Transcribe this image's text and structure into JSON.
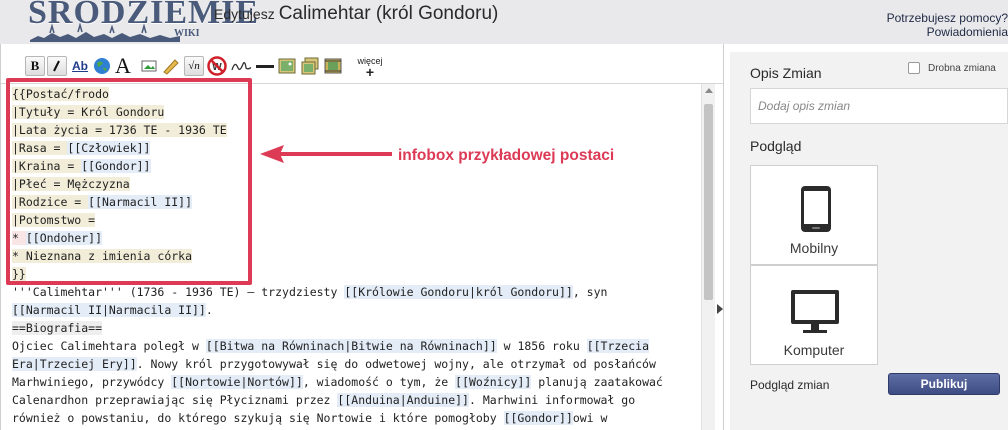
{
  "header": {
    "logo_text": "ŚRODZIEMIE",
    "logo_wiki": "WIKI",
    "edit_prefix": "Edytujesz",
    "page_title": "Calimehtar (król Gondoru)",
    "help_link": "Potrzebujesz pomocy?",
    "notifications_link": "Powiadomienia"
  },
  "toolbar": {
    "buttons": [
      {
        "name": "bold-button",
        "label": "B"
      },
      {
        "name": "italic-button",
        "label": "I"
      },
      {
        "name": "internal-link-button",
        "label": "Ab"
      },
      {
        "name": "external-link-button",
        "icon": "globe-icon"
      },
      {
        "name": "headline-button",
        "label": "A"
      },
      {
        "name": "embedded-image-button",
        "icon": "image-icon"
      },
      {
        "name": "media-link-button",
        "icon": "pencil-icon"
      },
      {
        "name": "math-button",
        "label": "√n"
      },
      {
        "name": "nowiki-button",
        "icon": "no-wiki-icon"
      },
      {
        "name": "signature-button",
        "icon": "signature-icon"
      },
      {
        "name": "horizontal-line-button",
        "icon": "horizontal-line-icon"
      },
      {
        "name": "insert-image-button",
        "icon": "picture-icon"
      },
      {
        "name": "insert-gallery-button",
        "icon": "gallery-icon"
      },
      {
        "name": "insert-video-button",
        "icon": "film-icon"
      }
    ],
    "more_label": "więcej",
    "more_plus": "+"
  },
  "editor": {
    "lines": [
      {
        "segments": [
          {
            "text": "{{Postać/frodo",
            "hl": "tpl"
          }
        ]
      },
      {
        "segments": [
          {
            "text": "|Tytuły = Król Gondoru",
            "hl": "tpl"
          }
        ]
      },
      {
        "segments": [
          {
            "text": "|Lata życia = 1736 TE - 1936 TE",
            "hl": "tpl"
          }
        ]
      },
      {
        "segments": [
          {
            "text": "|Rasa = ",
            "hl": "tpl"
          },
          {
            "text": "[[Człowiek]]",
            "hl": "link"
          }
        ]
      },
      {
        "segments": [
          {
            "text": "|Kraina = ",
            "hl": "tpl"
          },
          {
            "text": "[[Gondor]]",
            "hl": "link"
          }
        ]
      },
      {
        "segments": [
          {
            "text": "|Płeć = Mężczyzna",
            "hl": "tpl"
          }
        ]
      },
      {
        "segments": [
          {
            "text": "|Rodzice = ",
            "hl": "tpl"
          },
          {
            "text": "[[Narmacil II]]",
            "hl": "link"
          }
        ]
      },
      {
        "segments": [
          {
            "text": "|Potomstwo =",
            "hl": "tpl"
          }
        ]
      },
      {
        "segments": [
          {
            "text": "* ",
            "hl": "pink"
          },
          {
            "text": "[[Ondoher]]",
            "hl": "link"
          }
        ]
      },
      {
        "segments": [
          {
            "text": "* Nieznana z imienia córka",
            "hl": "tpl"
          }
        ]
      },
      {
        "segments": [
          {
            "text": "}}",
            "hl": "tpl"
          }
        ]
      },
      {
        "segments": [
          {
            "text": "'''Calimehtar''' (1736 - 1936 TE) – trzydziesty ",
            "hl": ""
          },
          {
            "text": "[[Królowie Gondoru|król Gondoru]]",
            "hl": "link"
          },
          {
            "text": ", syn",
            "hl": ""
          }
        ]
      },
      {
        "segments": [
          {
            "text": "[[Narmacil II|Narmacila II]]",
            "hl": "link"
          },
          {
            "text": ".",
            "hl": ""
          }
        ]
      },
      {
        "segments": [
          {
            "text": "==Biografia==",
            "hl": "head"
          }
        ]
      },
      {
        "segments": [
          {
            "text": "Ojciec Calimehtara poległ w ",
            "hl": ""
          },
          {
            "text": "[[Bitwa na Równinach|Bitwie na Równinach]]",
            "hl": "link"
          },
          {
            "text": " w 1856 roku ",
            "hl": ""
          },
          {
            "text": "[[Trzecia",
            "hl": "link"
          }
        ]
      },
      {
        "segments": [
          {
            "text": "Era|Trzeciej Ery]]",
            "hl": "link"
          },
          {
            "text": ". Nowy król przygotowywał się do odwetowej wojny, ale otrzymał od posłańców",
            "hl": ""
          }
        ]
      },
      {
        "segments": [
          {
            "text": "Marhwiniego, przywódcy ",
            "hl": ""
          },
          {
            "text": "[[Nortowie|Nortów]]",
            "hl": "link"
          },
          {
            "text": ", wiadomość o tym, że ",
            "hl": ""
          },
          {
            "text": "[[Woźnicy]]",
            "hl": "link"
          },
          {
            "text": " planują zaatakować",
            "hl": ""
          }
        ]
      },
      {
        "segments": [
          {
            "text": "Calenardhon przeprawiając się Płyciznami przez ",
            "hl": ""
          },
          {
            "text": "[[Anduina|Anduine]]",
            "hl": "link"
          },
          {
            "text": ". Marhwini informował go",
            "hl": ""
          }
        ]
      },
      {
        "segments": [
          {
            "text": "również o powstaniu, do którego szykują się Nortowie i które pomogłoby ",
            "hl": ""
          },
          {
            "text": "[[Gondor]]",
            "hl": "link"
          },
          {
            "text": "owi w",
            "hl": ""
          }
        ]
      }
    ]
  },
  "annotation": {
    "text": "infobox przykładowej postaci",
    "color": "#dc3a55"
  },
  "sidebar": {
    "summary_label": "Opis Zmian",
    "minor_edit_label": "Drobna zmiana",
    "minor_edit_checked": false,
    "summary_placeholder": "Dodaj opis zmian",
    "preview_label": "Podgląd",
    "mobile_label": "Mobilny",
    "desktop_label": "Komputer",
    "diff_link": "Podgląd zmian",
    "publish_label": "Publikuj"
  },
  "colors": {
    "header_bg": "#e9e9eb",
    "sidebar_bg": "#f2f2f2",
    "publish_bg": "#4a5890",
    "template_highlight": "#f2edd8",
    "link_highlight": "#e3ecf7"
  }
}
